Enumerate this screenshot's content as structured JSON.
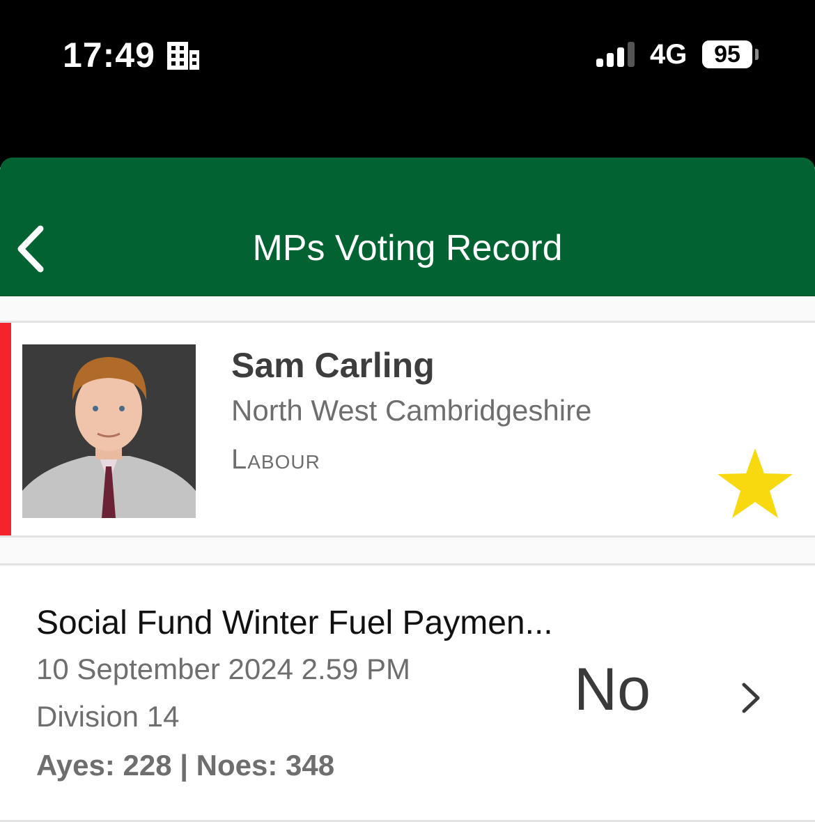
{
  "status_bar": {
    "time": "17:49",
    "network": "4G",
    "battery": "95"
  },
  "header": {
    "title": "MPs Voting Record",
    "background": "#026232"
  },
  "mp": {
    "name": "Sam Carling",
    "constituency": "North West Cambridgeshire",
    "party": "Labour",
    "party_color": "#f4242c",
    "favourite": true
  },
  "vote": {
    "title": "Social Fund Winter Fuel Paymen...",
    "date": "10 September 2024 2.59 PM",
    "division": "Division 14",
    "counts": "Ayes: 228 | Noes: 348",
    "answer": "No"
  }
}
